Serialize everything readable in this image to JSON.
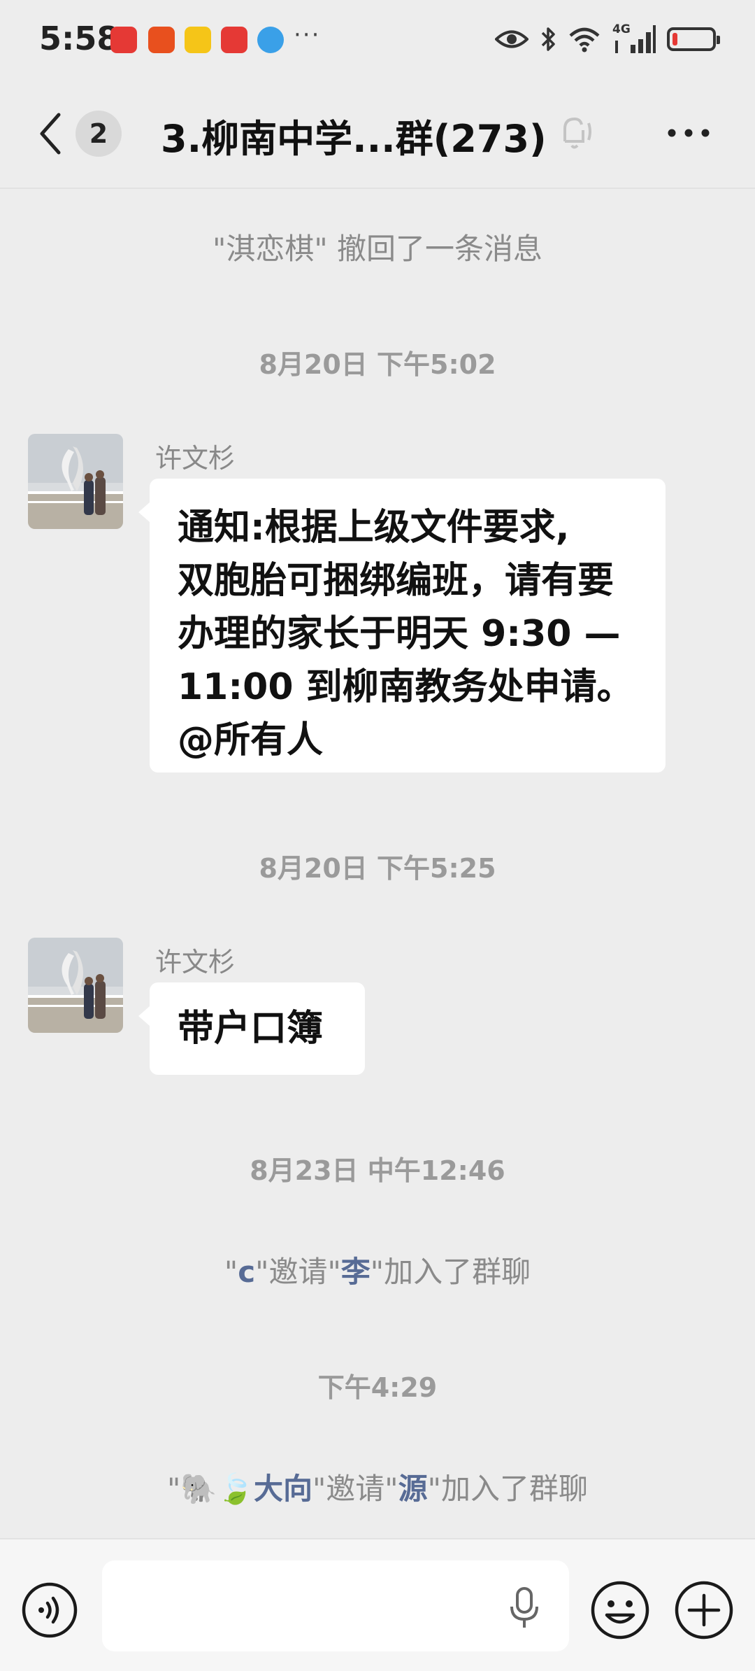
{
  "status_bar": {
    "time": "5:58",
    "notification_icons": [
      "huawei-store-icon",
      "app-notice-icon",
      "weibo-icon",
      "reader-icon",
      "browser-icon"
    ],
    "overflow": "···",
    "network": "4G",
    "icons": [
      "eye-icon",
      "bluetooth-icon",
      "wifi-icon",
      "signal-icon",
      "battery-icon"
    ],
    "battery_level": 0.12,
    "battery_color": "#e53935"
  },
  "header": {
    "unread_count": "2",
    "title": "3.柳南中学...群(273)"
  },
  "messages": {
    "recall_notice": "\"淇恋棋\" 撤回了一条消息",
    "time_1": "8月20日 下午5:02",
    "msg1_sender": "许文杉",
    "msg1_lines": [
      "通知:根据上级文件要求,",
      "双胞胎可捆绑编班，请有要",
      "办理的家长于明天 9:30 —",
      "11:00 到柳南教务处申请。",
      "@所有人"
    ],
    "time_2": "8月20日 下午5:25",
    "msg2_sender": "许文杉",
    "msg2_text": "带户口簿",
    "time_3": "8月23日 中午12:46",
    "invite1": {
      "q1": "\"",
      "inviter": "c",
      "mid": "\"邀请\"",
      "invitee": "李",
      "end": "\"加入了群聊"
    },
    "time_4": "下午4:29",
    "invite2": {
      "q1": "\"",
      "emoji": "🐘🍃",
      "inviter": "大向",
      "mid": "\"邀请\"",
      "invitee": "源",
      "end": "\"加入了群聊"
    }
  },
  "input_bar": {
    "placeholder": ""
  },
  "colors": {
    "background": "#ededed",
    "link_name": "#576b95",
    "system_text": "#8a8a8a"
  }
}
